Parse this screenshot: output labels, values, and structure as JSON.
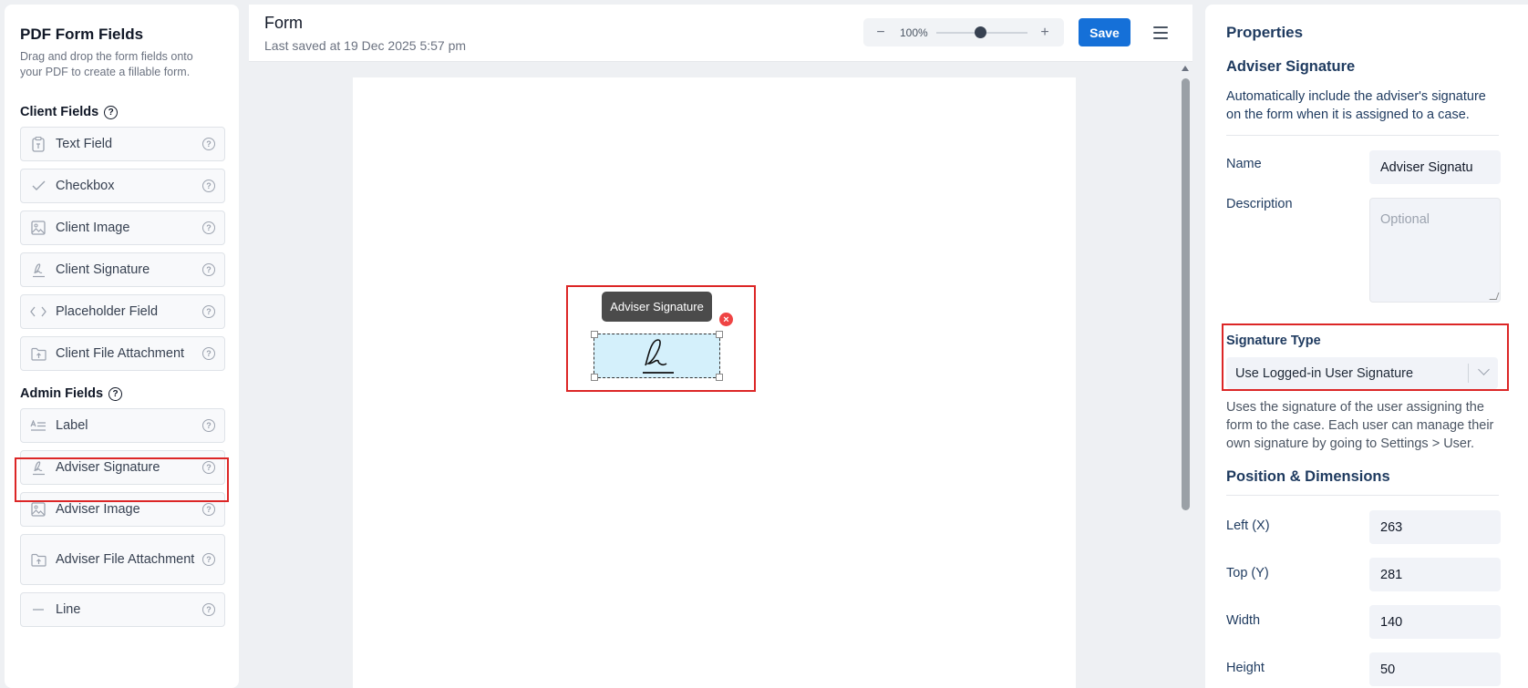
{
  "sidebar": {
    "title": "PDF Form Fields",
    "description": "Drag and drop the form fields onto your PDF to create a fillable form.",
    "client_section": "Client Fields",
    "admin_section": "Admin Fields",
    "client_fields": [
      {
        "label": "Text Field",
        "icon": "clipboard-icon"
      },
      {
        "label": "Checkbox",
        "icon": "check-icon"
      },
      {
        "label": "Client Image",
        "icon": "image-icon"
      },
      {
        "label": "Client Signature",
        "icon": "signature-icon"
      },
      {
        "label": "Placeholder Field",
        "icon": "code-brackets-icon"
      },
      {
        "label": "Client File Attachment",
        "icon": "folder-upload-icon"
      }
    ],
    "admin_fields": [
      {
        "label": "Label",
        "icon": "text-label-icon"
      },
      {
        "label": "Adviser Signature",
        "icon": "signature-icon"
      },
      {
        "label": "Adviser Image",
        "icon": "image-icon"
      },
      {
        "label": "Adviser File Attachment",
        "icon": "folder-upload-icon"
      },
      {
        "label": "Line",
        "icon": "line-icon"
      }
    ]
  },
  "header": {
    "title": "Form",
    "subtitle": "Last saved at 19 Dec 2025 5:57 pm",
    "zoom_level": "100%",
    "save_label": "Save"
  },
  "canvas": {
    "tooltip": "Adviser Signature",
    "remove_symbol": "×"
  },
  "properties": {
    "title": "Properties",
    "field_title": "Adviser Signature",
    "field_description": "Automatically include the adviser's signature on the form when it is assigned to a case.",
    "name_label": "Name",
    "name_value": "Adviser Signatu",
    "description_label": "Description",
    "description_placeholder": "Optional",
    "signature_type_label": "Signature Type",
    "signature_type_value": "Use Logged-in User Signature",
    "signature_help": "Uses the signature of the user assigning the form to the case. Each user can manage their own signature by going to Settings > User.",
    "position_title": "Position & Dimensions",
    "left_label": "Left (X)",
    "left_value": "263",
    "top_label": "Top (Y)",
    "top_value": "281",
    "width_label": "Width",
    "width_value": "140",
    "height_label": "Height",
    "height_value": "50"
  },
  "colors": {
    "accent": "#1570d8",
    "highlight": "#dc2626",
    "signature_fill": "#d4f0fb",
    "remove": "#ef4444"
  }
}
